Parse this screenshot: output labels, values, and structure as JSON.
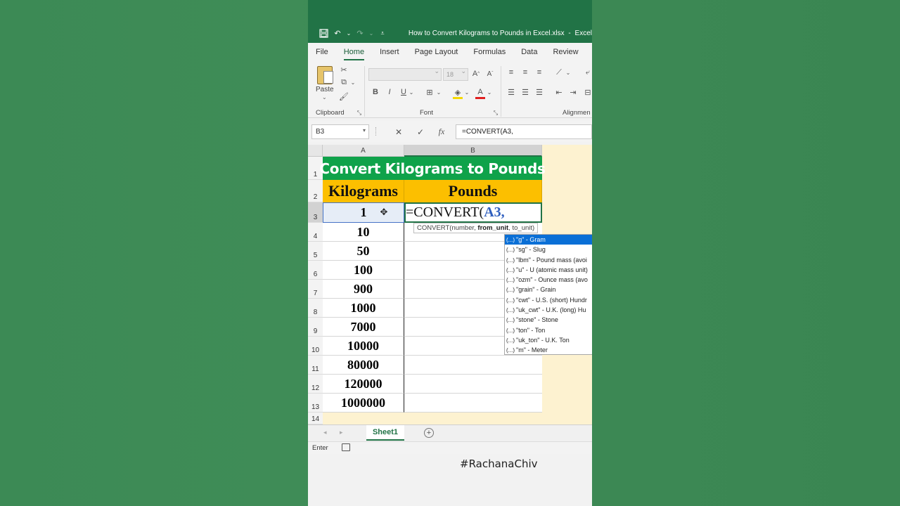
{
  "window": {
    "document_title": "How to Convert Kilograms to Pounds in Excel.xlsx",
    "app_name": "Excel",
    "title_separator": "-"
  },
  "ribbon": {
    "tabs": [
      "File",
      "Home",
      "Insert",
      "Page Layout",
      "Formulas",
      "Data",
      "Review"
    ],
    "active_tab": "Home",
    "groups": {
      "clipboard": {
        "label": "Clipboard",
        "paste_label": "Paste"
      },
      "font": {
        "label": "Font",
        "font_size": "18"
      },
      "alignment": {
        "label": "Alignmen"
      }
    },
    "font_buttons": [
      "B",
      "I",
      "U"
    ]
  },
  "formula_bar": {
    "name_box": "B3",
    "formula": "=CONVERT(A3,",
    "fx_label": "fx"
  },
  "sheet": {
    "columns": [
      "A",
      "B"
    ],
    "rows": [
      "1",
      "2",
      "3",
      "4",
      "5",
      "6",
      "7",
      "8",
      "9",
      "10",
      "11",
      "12",
      "13",
      "14"
    ],
    "title": "Convert Kilograms to Pounds",
    "header_a": "Kilograms",
    "header_b": "Pounds",
    "kilograms": [
      "1",
      "10",
      "50",
      "100",
      "900",
      "1000",
      "7000",
      "10000",
      "80000",
      "120000",
      "1000000"
    ],
    "active_cell_prefix": "=CONVERT(",
    "active_cell_ref": "A3,",
    "tooltip_prefix": "CONVERT(number, ",
    "tooltip_bold": "from_unit",
    "tooltip_suffix": ", to_unit)"
  },
  "autocomplete": [
    "\"g\" - Gram",
    "\"sg\" - Slug",
    "\"lbm\" - Pound mass (avoi",
    "\"u\" - U (atomic mass unit)",
    "\"ozm\" - Ounce mass (avo",
    "\"grain\" - Grain",
    "\"cwt\" - U.S. (short) Hundr",
    "\"uk_cwt\" - U.K. (long) Hu",
    "\"stone\" - Stone",
    "\"ton\" - Ton",
    "\"uk_ton\" - U.K. Ton",
    "\"m\" - Meter"
  ],
  "autocomplete_param_icon": "(...)",
  "sheet_tabs": {
    "active": "Sheet1",
    "add_symbol": "+"
  },
  "status": {
    "mode": "Enter"
  },
  "watermark": "#RachanaChiv",
  "colors": {
    "excel_green": "#217346",
    "title_fill": "#0fa24a",
    "header_fill": "#fcbf00",
    "selection_blue": "#0a6fd6",
    "background_fill": "#fdf2d0"
  }
}
